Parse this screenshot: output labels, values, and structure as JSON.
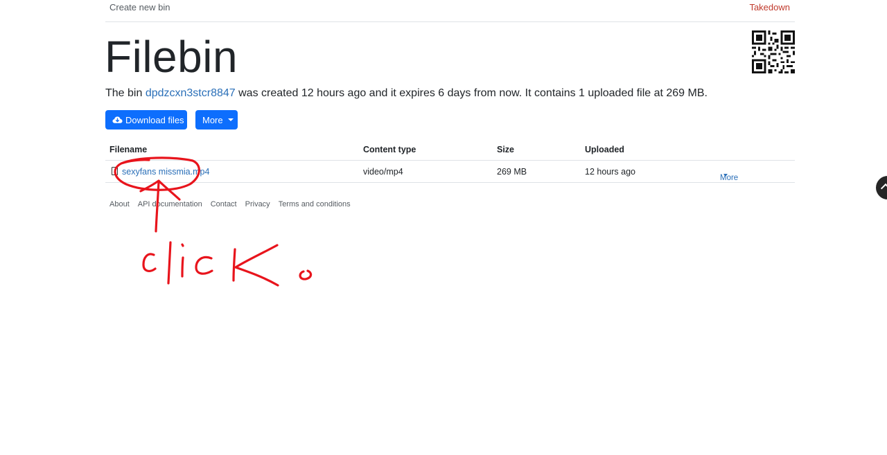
{
  "nav": {
    "create_label": "Create new bin",
    "takedown_label": "Takedown"
  },
  "page": {
    "title": "Filebin"
  },
  "summary": {
    "prefix": "The bin ",
    "bin_id": "dpdzcxn3stcr8847",
    "suffix": " was created 12 hours ago and it expires 6 days from now. It contains 1 uploaded file at 269 MB."
  },
  "toolbar": {
    "download_label": "Download files",
    "more_label": "More"
  },
  "table": {
    "headers": [
      "Filename",
      "Content type",
      "Size",
      "Uploaded"
    ],
    "rows": [
      {
        "filename": "sexyfans missmia.mp4",
        "content_type": "video/mp4",
        "size": "269 MB",
        "uploaded": "12 hours ago",
        "more_label": "More"
      }
    ]
  },
  "footer": {
    "links": [
      "About",
      "API documentation",
      "Contact",
      "Privacy",
      "Terms and conditions"
    ]
  },
  "icons": {
    "download": "cloud-download-icon",
    "file": "file-icon",
    "qr": "qr-code-icon",
    "scroll": "chevron-up-icon"
  },
  "colors": {
    "primary": "#0d6efd",
    "link": "#2a6fb8",
    "takedown": "#c0392b",
    "annotation": "#e8141c"
  },
  "annotation": {
    "handwritten_text": "click"
  }
}
